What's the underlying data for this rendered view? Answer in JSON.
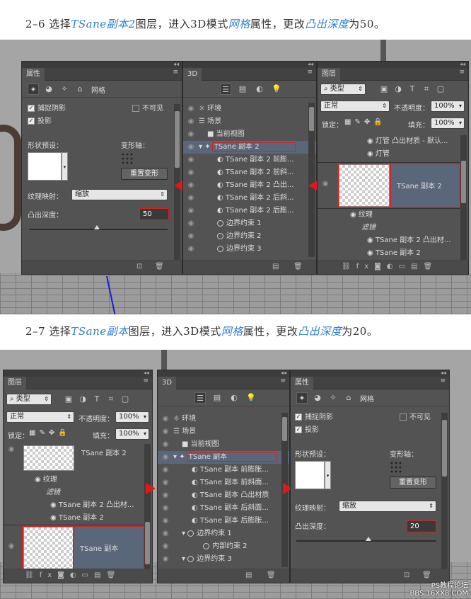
{
  "caption1": {
    "pre": "2–6 选择",
    "k1": "TSane副本2",
    "m1": "图层，进入3D模式",
    "k2": "网格",
    "m2": "属性，更改",
    "k3": "凸出深度",
    "post": "为50。"
  },
  "caption2": {
    "pre": "2–7 选择",
    "k1": "TSane副本",
    "m1": "图层，进入3D模式",
    "k2": "网格",
    "m2": "属性，更改",
    "k3": "凸出深度",
    "post": "为20。"
  },
  "props": {
    "tab": "属性",
    "tab_label": "网格",
    "catch_shadow": "捕捉阴影",
    "invisible": "不可见",
    "cast_shadow": "投影",
    "shape_preset": "形状预设：",
    "deform_axis": "变形轴：",
    "reset_deform": "重置变形",
    "texture_map": "纹理映射：",
    "texture_value": "缩放",
    "depth_label": "凸出深度：",
    "depth1": "50",
    "depth2": "20"
  },
  "scene": {
    "tab": "3D",
    "s1_items": [
      "环境",
      "场景",
      "当前视图",
      "TSane 副本 2",
      "TSane 副本 2 前膨...",
      "TSane 副本 2 前斜...",
      "TSane 副本 2 凸出...",
      "TSane 副本 2 后斜...",
      "TSane 副本 2 后膨...",
      "边界约束 1",
      "边界约束 2",
      "边界约束 3"
    ],
    "s2_items": [
      "环境",
      "场景",
      "当前视图",
      "TSane 副本",
      "TSane 副本 前膨胀...",
      "TSane 副本 前斜面...",
      "TSane 副本 凸出材质",
      "TSane 副本 后斜面...",
      "TSane 副本 后膨胀...",
      "边界约束 1",
      "内部约束 2",
      "边界约束 3"
    ]
  },
  "layers": {
    "tab": "图层",
    "kind": "类型",
    "blend": "正常",
    "opacity_label": "不透明度：",
    "opacity": "100%",
    "lock": "锁定：",
    "fill_label": "填充：",
    "fill": "100%",
    "s1_items": [
      "灯管 凸出材质 - 默认...",
      "灯管",
      "TSane 副本 2",
      "纹理",
      "滤镜",
      "TSane 副本 2 凸出材...",
      "TSane 副本 2"
    ],
    "s2_items": [
      "TSane 副本 2",
      "纹理",
      "滤镜",
      "TSane 副本 2 凸出材...",
      "TSane 副本 2",
      "TSane 副本"
    ]
  },
  "watermark": {
    "line1": "PS教程论坛",
    "line2": "BBS.16XX8.COM"
  }
}
